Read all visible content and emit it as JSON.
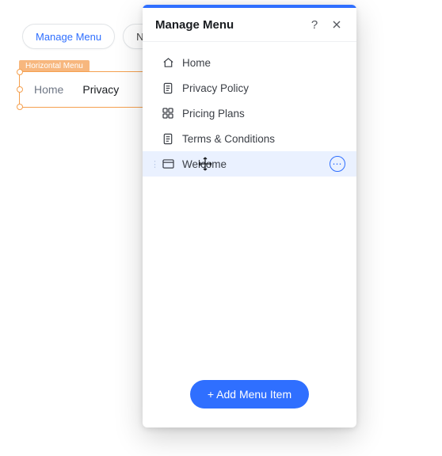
{
  "bg": {
    "pill_primary": "Manage Menu",
    "pill_secondary": "Navigation",
    "badge": "Horizontal Menu",
    "nav_items": [
      "Home",
      "Privacy"
    ]
  },
  "panel": {
    "title": "Manage Menu",
    "items": [
      {
        "label": "Home",
        "icon": "home-icon",
        "selected": false
      },
      {
        "label": "Privacy Policy",
        "icon": "page-icon",
        "selected": false
      },
      {
        "label": "Pricing Plans",
        "icon": "grid-icon",
        "selected": false
      },
      {
        "label": "Terms & Conditions",
        "icon": "page-icon",
        "selected": false
      },
      {
        "label": "Welcome",
        "icon": "browser-icon",
        "selected": true
      }
    ],
    "add_button": "+ Add Menu Item"
  }
}
